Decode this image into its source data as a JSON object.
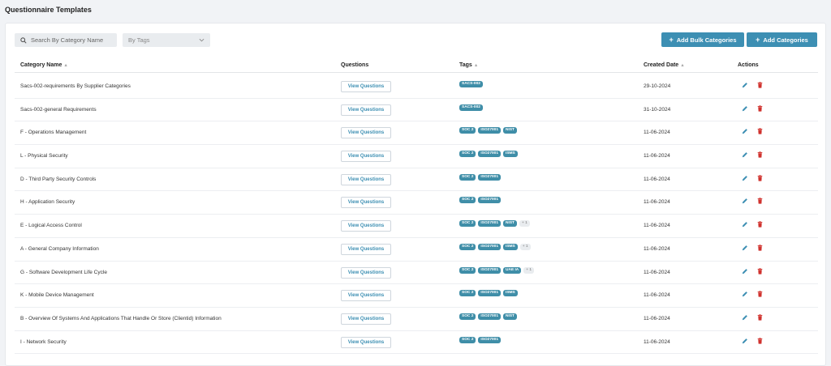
{
  "page_title": "Questionnaire Templates",
  "search": {
    "placeholder": "Search By Category Name"
  },
  "tag_filter": {
    "placeholder": "By Tags"
  },
  "buttons": {
    "add_bulk": "Add Bulk Categories",
    "add": "Add Categories"
  },
  "table": {
    "headers": {
      "category": "Category Name",
      "questions": "Questions",
      "tags": "Tags",
      "created": "Created Date",
      "actions": "Actions"
    },
    "view_label": "View Questions",
    "rows": [
      {
        "name": "Sacs-002-requirements By Supplier Categories",
        "tags": [
          "SACS-002"
        ],
        "more": "",
        "date": "29-10-2024"
      },
      {
        "name": "Sacs-002-general Requirements",
        "tags": [
          "SACS-002"
        ],
        "more": "",
        "date": "31-10-2024"
      },
      {
        "name": "F - Operations Management",
        "tags": [
          "SOC 2",
          "ISO27001",
          "NIST"
        ],
        "more": "",
        "date": "11-06-2024"
      },
      {
        "name": "L - Physical Security",
        "tags": [
          "SOC 2",
          "ISO27001",
          "ISMS"
        ],
        "more": "",
        "date": "11-06-2024"
      },
      {
        "name": "D - Third Party Security Controls",
        "tags": [
          "SOC 2",
          "ISO27001"
        ],
        "more": "",
        "date": "11-06-2024"
      },
      {
        "name": "H - Application Security",
        "tags": [
          "SOC 2",
          "ISO27001"
        ],
        "more": "",
        "date": "11-06-2024"
      },
      {
        "name": "E - Logical Access Control",
        "tags": [
          "SOC 2",
          "ISO27001",
          "NIST"
        ],
        "more": "+ 1",
        "date": "11-06-2024"
      },
      {
        "name": "A - General Company Information",
        "tags": [
          "SOC 2",
          "ISO27001",
          "ISMS"
        ],
        "more": "+ 1",
        "date": "11-06-2024"
      },
      {
        "name": "G - Software Development Life Cycle",
        "tags": [
          "SOC 2",
          "ISO27001",
          "UAE IA"
        ],
        "more": "+ 1",
        "date": "11-06-2024"
      },
      {
        "name": "K - Mobile Device Management",
        "tags": [
          "SOC 2",
          "ISO27001",
          "ISMS"
        ],
        "more": "",
        "date": "11-06-2024"
      },
      {
        "name": "B - Overview Of Systems And Applications That Handle Or Store (Clientid) Information",
        "tags": [
          "SOC 2",
          "ISO27001",
          "NIST"
        ],
        "more": "",
        "date": "11-06-2024"
      },
      {
        "name": "I - Network Security",
        "tags": [
          "SOC 2",
          "ISO27001"
        ],
        "more": "",
        "date": "11-06-2024"
      }
    ]
  },
  "colors": {
    "accent": "#3d8fb3",
    "tag": "#3f8ea8",
    "delete": "#d0312d",
    "edit": "#3d8fb3"
  },
  "icons": {
    "search": "search-icon",
    "dropdown": "chevron-down-icon",
    "edit": "pencil-icon",
    "delete": "trash-icon",
    "sort": "sort-arrow-icon"
  }
}
